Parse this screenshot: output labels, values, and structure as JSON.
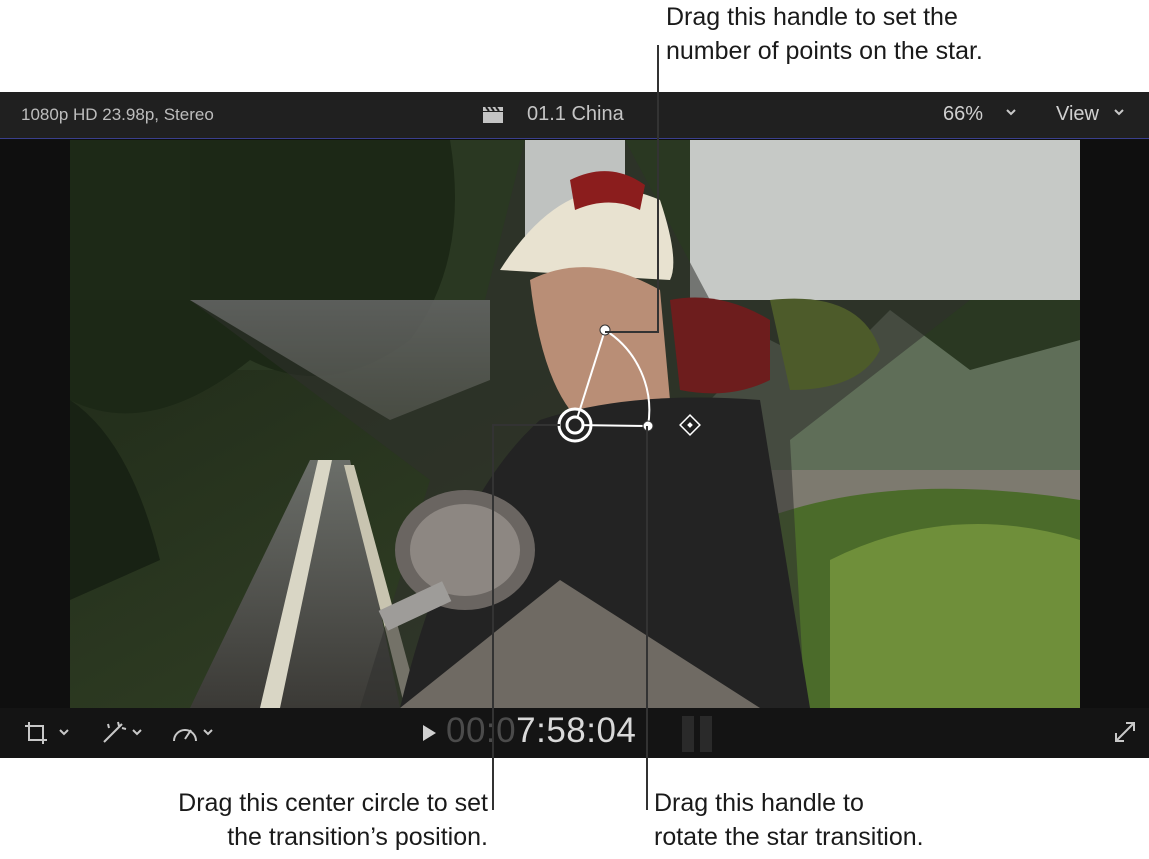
{
  "callouts": {
    "top_line1": "Drag this handle to set the",
    "top_line2": "number of points on the star.",
    "left_line1": "Drag this center circle to set",
    "left_line2": "the transition’s position.",
    "right_line1": "Drag this handle to",
    "right_line2": "rotate the star transition."
  },
  "viewer": {
    "format": "1080p HD 23.98p, Stereo",
    "clip_title": "01.1 China",
    "zoom": "66%",
    "view_menu": "View",
    "timecode_dim": "00:0",
    "timecode_bright": "7:58:04"
  },
  "icons": {
    "clapper": "clapperboard-icon",
    "crop": "crop-icon",
    "enhance": "magic-wand-icon",
    "speed": "speedometer-icon",
    "play": "play-icon",
    "fullscreen": "fullscreen-icon"
  },
  "colors": {
    "accent_line": "#3a3f8c",
    "ui_dark": "#202020"
  }
}
